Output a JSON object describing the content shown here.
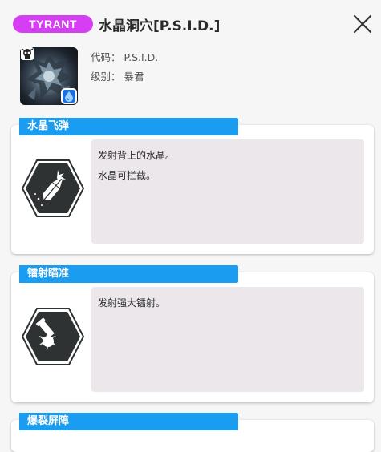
{
  "header": {
    "tier_badge": "TYRANT",
    "title": "水晶洞穴[P.S.I.D.]"
  },
  "info": {
    "code_label": "代码：",
    "code_value": "P.S.I.D.",
    "level_label": "级别：",
    "level_value": "暴君"
  },
  "colors": {
    "badge": "#d63ef3",
    "skill_header": "#1a9cf0",
    "description_bg": "#ebe7ea",
    "element_icon": "#1c6fe0"
  },
  "skills": [
    {
      "name": "水晶飞弹",
      "icon": "crystal-missile-icon",
      "description": [
        "发射背上的水晶。",
        "水晶可拦截。"
      ]
    },
    {
      "name": "镭射瞄准",
      "icon": "laser-aim-icon",
      "description": [
        "发射强大镭射。"
      ]
    },
    {
      "name": "爆裂屏障"
    }
  ]
}
